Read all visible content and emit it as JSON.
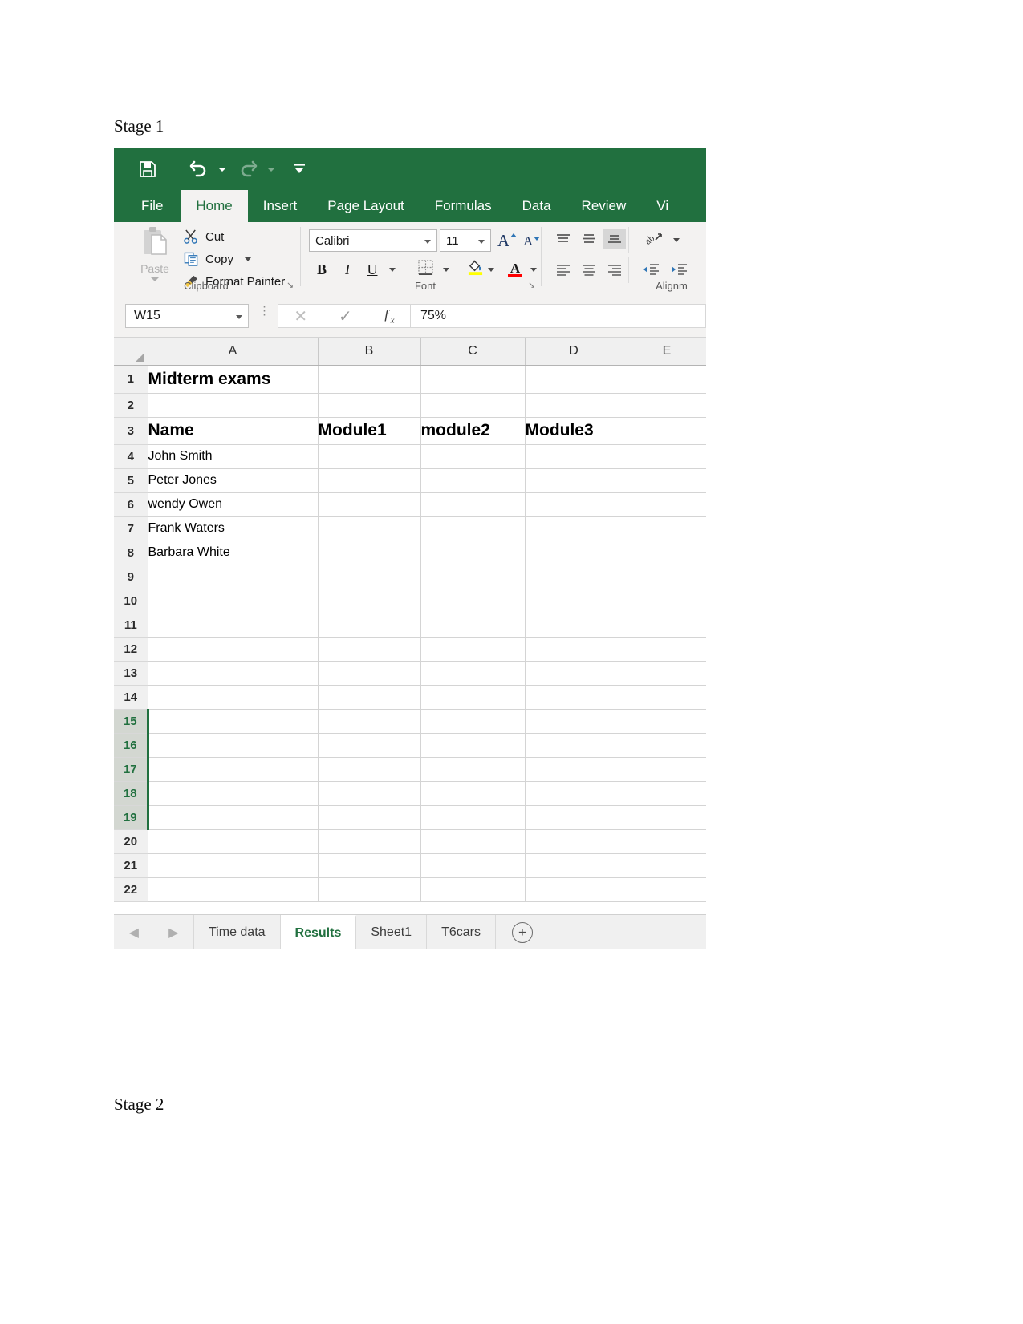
{
  "document": {
    "stage1_label": "Stage 1",
    "stage2_label": "Stage 2"
  },
  "quick_access": {
    "save": "Save",
    "undo": "Undo",
    "redo": "Redo",
    "customize": "Customize Quick Access Toolbar"
  },
  "ribbon": {
    "tabs": [
      {
        "label": "File",
        "active": false
      },
      {
        "label": "Home",
        "active": true
      },
      {
        "label": "Insert",
        "active": false
      },
      {
        "label": "Page Layout",
        "active": false
      },
      {
        "label": "Formulas",
        "active": false
      },
      {
        "label": "Data",
        "active": false
      },
      {
        "label": "Review",
        "active": false
      },
      {
        "label": "Vi",
        "active": false
      }
    ],
    "clipboard": {
      "group_label": "Clipboard",
      "paste": "Paste",
      "cut": "Cut",
      "copy": "Copy",
      "format_painter": "Format Painter"
    },
    "font": {
      "group_label": "Font",
      "font_name": "Calibri",
      "font_size": "11",
      "grow_font": "A",
      "shrink_font": "A",
      "bold": "B",
      "italic": "I",
      "underline": "U"
    },
    "alignment": {
      "group_label": "Alignm"
    }
  },
  "formula_bar": {
    "name_box_value": "W15",
    "cancel": "✕",
    "enter": "✓",
    "insert_function": "fx",
    "formula_value": "75%"
  },
  "grid": {
    "columns": [
      "A",
      "B",
      "C",
      "D",
      "E"
    ],
    "rows": [
      {
        "num": "1",
        "selected": false,
        "cells": [
          "Midterm exams",
          "",
          "",
          "",
          ""
        ],
        "style": "title"
      },
      {
        "num": "2",
        "selected": false,
        "cells": [
          "",
          "",
          "",
          "",
          ""
        ],
        "style": ""
      },
      {
        "num": "3",
        "selected": false,
        "cells": [
          "Name",
          "Module1",
          "module2",
          "Module3",
          ""
        ],
        "style": "header"
      },
      {
        "num": "4",
        "selected": false,
        "cells": [
          "John Smith",
          "",
          "",
          "",
          ""
        ],
        "style": ""
      },
      {
        "num": "5",
        "selected": false,
        "cells": [
          "Peter Jones",
          "",
          "",
          "",
          ""
        ],
        "style": ""
      },
      {
        "num": "6",
        "selected": false,
        "cells": [
          "wendy Owen",
          "",
          "",
          "",
          ""
        ],
        "style": ""
      },
      {
        "num": "7",
        "selected": false,
        "cells": [
          "Frank Waters",
          "",
          "",
          "",
          ""
        ],
        "style": ""
      },
      {
        "num": "8",
        "selected": false,
        "cells": [
          "Barbara White",
          "",
          "",
          "",
          ""
        ],
        "style": ""
      },
      {
        "num": "9",
        "selected": false,
        "cells": [
          "",
          "",
          "",
          "",
          ""
        ],
        "style": ""
      },
      {
        "num": "10",
        "selected": false,
        "cells": [
          "",
          "",
          "",
          "",
          ""
        ],
        "style": ""
      },
      {
        "num": "11",
        "selected": false,
        "cells": [
          "",
          "",
          "",
          "",
          ""
        ],
        "style": ""
      },
      {
        "num": "12",
        "selected": false,
        "cells": [
          "",
          "",
          "",
          "",
          ""
        ],
        "style": ""
      },
      {
        "num": "13",
        "selected": false,
        "cells": [
          "",
          "",
          "",
          "",
          ""
        ],
        "style": ""
      },
      {
        "num": "14",
        "selected": false,
        "cells": [
          "",
          "",
          "",
          "",
          ""
        ],
        "style": ""
      },
      {
        "num": "15",
        "selected": true,
        "cells": [
          "",
          "",
          "",
          "",
          ""
        ],
        "style": ""
      },
      {
        "num": "16",
        "selected": true,
        "cells": [
          "",
          "",
          "",
          "",
          ""
        ],
        "style": ""
      },
      {
        "num": "17",
        "selected": true,
        "cells": [
          "",
          "",
          "",
          "",
          ""
        ],
        "style": ""
      },
      {
        "num": "18",
        "selected": true,
        "cells": [
          "",
          "",
          "",
          "",
          ""
        ],
        "style": ""
      },
      {
        "num": "19",
        "selected": true,
        "cells": [
          "",
          "",
          "",
          "",
          ""
        ],
        "style": ""
      },
      {
        "num": "20",
        "selected": false,
        "cells": [
          "",
          "",
          "",
          "",
          ""
        ],
        "style": ""
      },
      {
        "num": "21",
        "selected": false,
        "cells": [
          "",
          "",
          "",
          "",
          ""
        ],
        "style": ""
      },
      {
        "num": "22",
        "selected": false,
        "cells": [
          "",
          "",
          "",
          "",
          ""
        ],
        "style": ""
      }
    ]
  },
  "sheet_tabs": {
    "items": [
      {
        "label": "Time data",
        "active": false
      },
      {
        "label": "Results",
        "active": true
      },
      {
        "label": "Sheet1",
        "active": false
      },
      {
        "label": "T6cars",
        "active": false
      }
    ],
    "add_label": "+"
  },
  "colors": {
    "ribbon_green": "#21703f",
    "accent_tab_text": "#21703f",
    "selection_green": "#21703f",
    "font_color_red": "#ff0000",
    "highlight_yellow": "#ffff00"
  }
}
